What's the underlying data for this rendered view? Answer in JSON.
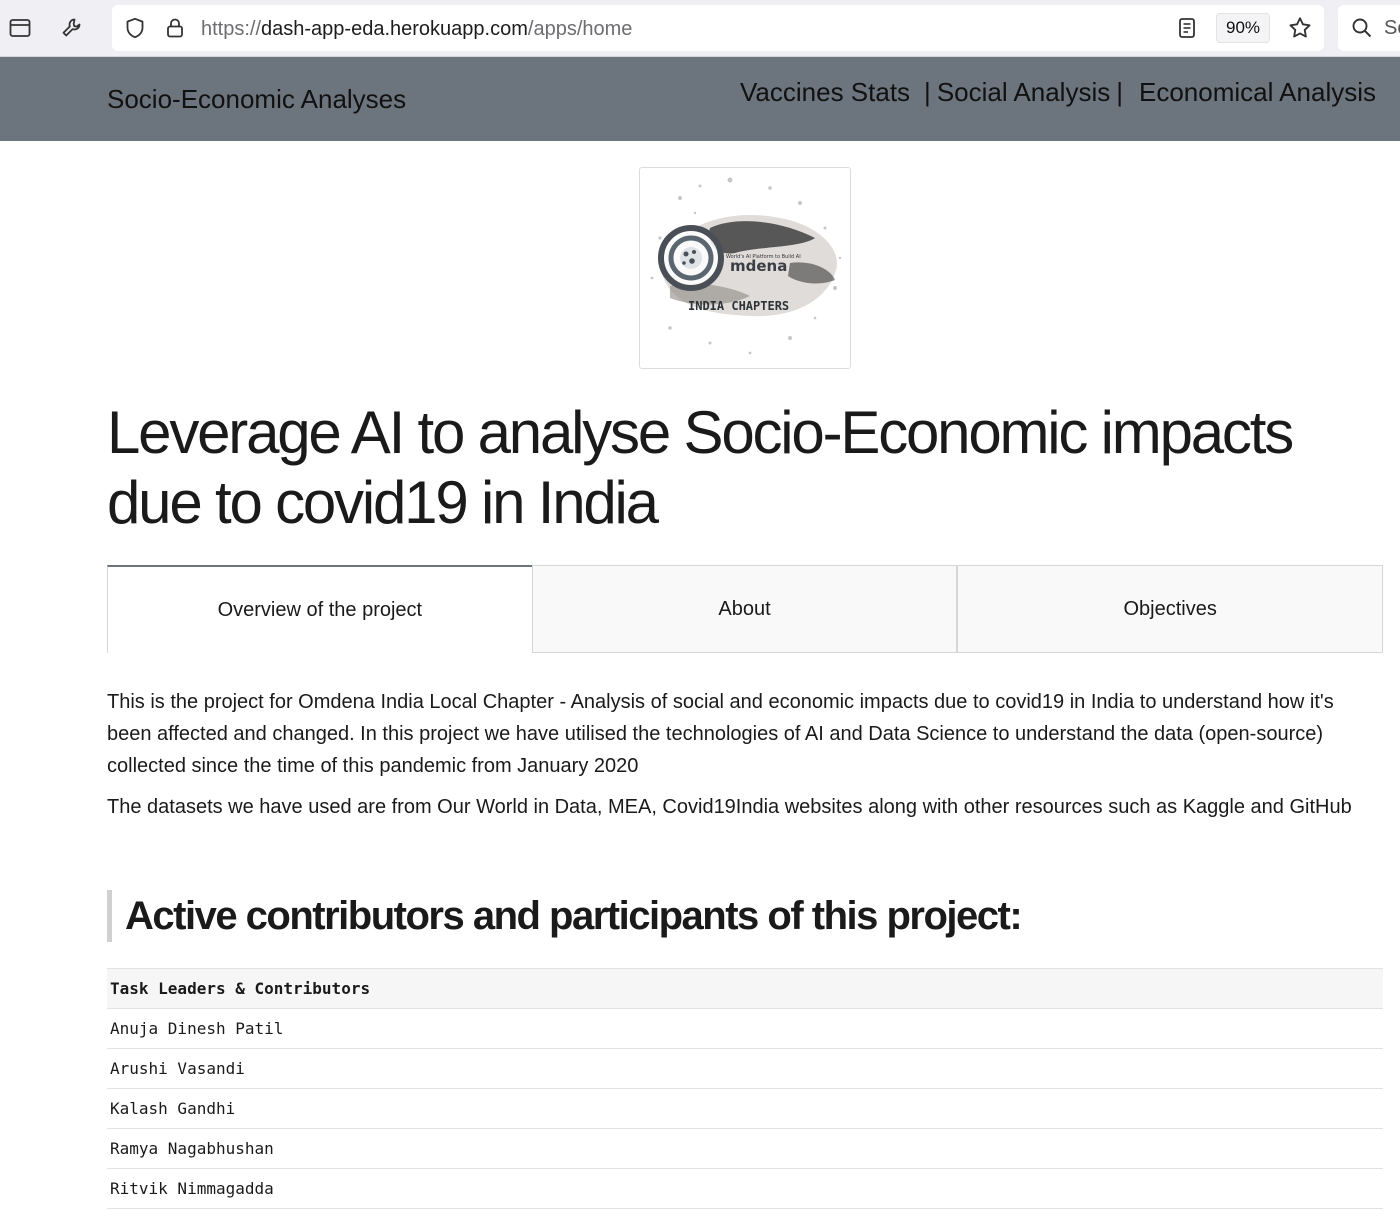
{
  "browser": {
    "url_scheme": "https://",
    "url_host": "dash-app-eda.herokuapp.com",
    "url_path": "/apps/home",
    "zoom": "90%",
    "search_partial": "Se",
    "icons": [
      "sidebar-icon",
      "wrench-icon",
      "shield-icon",
      "lock-icon",
      "reader-view-icon",
      "star-icon",
      "search-icon"
    ]
  },
  "nav": {
    "brand": "Socio-Economic Analyses",
    "links": [
      "Vaccines Stats",
      "Social Analysis",
      "Economical Analysis"
    ],
    "separator": "|"
  },
  "logo": {
    "tagline": "World's AI Platform to Build AI",
    "name": "mdena",
    "subtitle": "INDIA CHAPTERS"
  },
  "headline": "Leverage AI to analyse Socio-Economic impacts due to covid19 in India",
  "tabs": [
    {
      "label": "Overview of the project",
      "active": true
    },
    {
      "label": "About",
      "active": false
    },
    {
      "label": "Objectives",
      "active": false
    }
  ],
  "overview": {
    "paragraph1": "This is the project for Omdena India Local Chapter - Analysis of social and economic impacts due to covid19 in India to understand how it's been affected and changed. In this project we have utilised the technologies of AI and Data Science to understand the data (open-source) collected since the time of this pandemic from January 2020",
    "paragraph2": "The datasets we have used are from Our World in Data, MEA, Covid19India websites along with other resources such as Kaggle and GitHub"
  },
  "contributors": {
    "heading": "Active contributors and participants of this project:",
    "column_header": "Task Leaders & Contributors",
    "rows": [
      "Anuja Dinesh Patil",
      "Arushi Vasandi",
      "Kalash Gandhi",
      "Ramya Nagabhushan",
      "Ritvik Nimmagadda"
    ]
  },
  "colors": {
    "nav_bg": "#6c757d",
    "toolbar_bg": "#f0f0f4"
  }
}
